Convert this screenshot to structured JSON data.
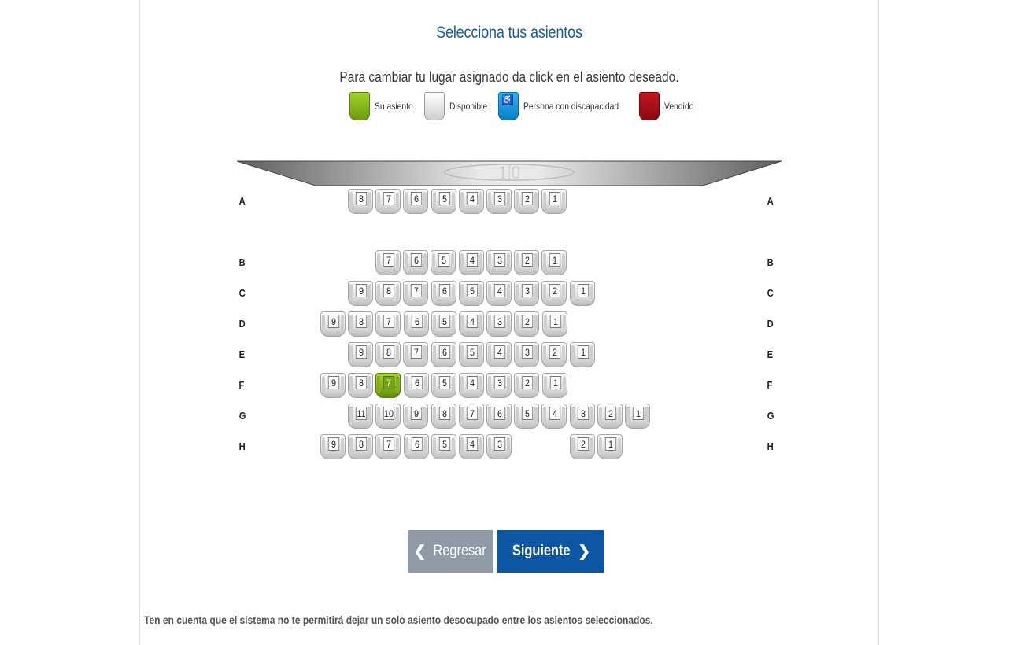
{
  "page": {
    "title": "Selecciona tus asientos",
    "subtitle": "Para cambiar tu lugar asignado da click en el asiento deseado."
  },
  "legend": [
    {
      "key": "selected",
      "label": "Su asiento",
      "color": "#8cc21f"
    },
    {
      "key": "available",
      "label": "Disponible",
      "color": "#e6e6e6"
    },
    {
      "key": "accessible",
      "label": "Persona con discapacidad",
      "color": "#1ea3e6"
    },
    {
      "key": "sold",
      "label": "Vendido",
      "color": "#b01018"
    }
  ],
  "screen": {
    "label": "1|0"
  },
  "rows": [
    {
      "row": "A",
      "seats": [
        8,
        7,
        6,
        5,
        4,
        3,
        2,
        1
      ]
    },
    {
      "row": "B",
      "seats": [
        7,
        6,
        5,
        4,
        3,
        2,
        1
      ]
    },
    {
      "row": "C",
      "seats": [
        9,
        8,
        7,
        6,
        5,
        4,
        3,
        2,
        1
      ]
    },
    {
      "row": "D",
      "seats": [
        9,
        8,
        7,
        6,
        5,
        4,
        3,
        2,
        1
      ]
    },
    {
      "row": "E",
      "seats": [
        9,
        8,
        7,
        6,
        5,
        4,
        3,
        2,
        1
      ]
    },
    {
      "row": "F",
      "seats": [
        9,
        8,
        7,
        6,
        5,
        4,
        3,
        2,
        1
      ],
      "selected": 7
    },
    {
      "row": "G",
      "seats": [
        11,
        10,
        9,
        8,
        7,
        6,
        5,
        4,
        3,
        2,
        1
      ]
    },
    {
      "row": "H",
      "seats": [
        9,
        8,
        7,
        6,
        5,
        4,
        3,
        2,
        1
      ]
    }
  ],
  "buttons": {
    "back": {
      "label": "Regresar",
      "chevron": "❮"
    },
    "next": {
      "label": "Siguiente",
      "chevron": "❯"
    }
  },
  "note": "Ten en cuenta que el sistema no te permitirá dejar un solo asiento desocupado entre los asientos seleccionados."
}
